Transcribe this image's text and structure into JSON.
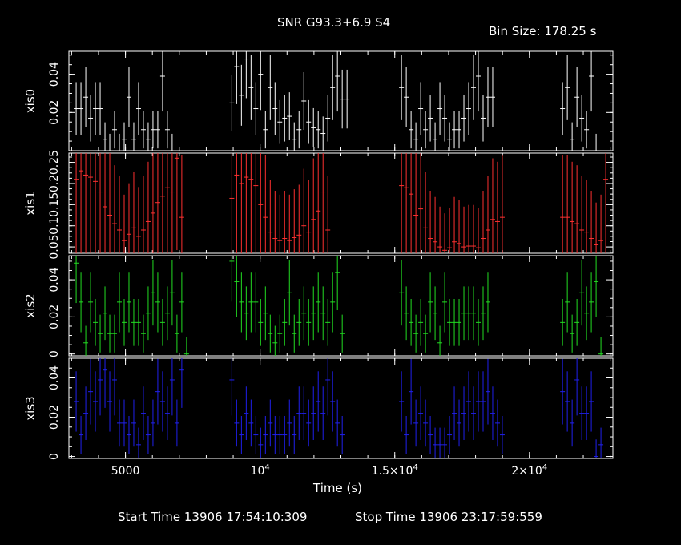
{
  "header": {
    "title": "SNR G93.3+6.9 S4",
    "bin_size": "Bin Size: 178.25 s"
  },
  "footer": {
    "start_time": "Start Time 13906 17:54:10:309",
    "stop_time": "Stop Time 13906 23:17:59:559"
  },
  "chart_data": {
    "type": "scatter",
    "style": "crosshair points with vertical error bars, stacked panels sharing x axis",
    "xlabel": "Time (s)",
    "xlim": [
      2900,
      23100
    ],
    "x_ticks": [
      {
        "value": 5000,
        "label": "5000"
      },
      {
        "value": 10000,
        "label": "10^4"
      },
      {
        "value": 15000,
        "label": "1.5×10^4"
      },
      {
        "value": 20000,
        "label": "2×10^4"
      }
    ],
    "bin_size": 178.25,
    "panels": [
      {
        "name": "xis0",
        "color": "#ffffff",
        "ylim": [
          0,
          0.052
        ],
        "ticks": [
          {
            "value": 0,
            "label": ""
          },
          {
            "value": 0.02,
            "label": "0.02"
          },
          {
            "value": 0.04,
            "label": "0.04"
          }
        ],
        "segments": [
          {
            "x0": 3170,
            "y": [
              0.022,
              0.022,
              0.028,
              0.017,
              0.022,
              0.022,
              0.006,
              0.0,
              0.011,
              0.0,
              0.006,
              0.028,
              0.006,
              0.022,
              0.011,
              0.006,
              0.011,
              0.011,
              0.039,
              0.011,
              0.0
            ]
          },
          {
            "x0": 8950,
            "y": [
              0.025,
              0.044,
              0.029,
              0.048,
              0.033,
              0.022,
              0.04,
              0.011,
              0.033,
              0.022,
              0.015,
              0.017,
              0.018,
              0.006,
              0.011,
              0.026,
              0.015,
              0.012,
              0.011,
              0.009,
              0.017,
              0.033,
              0.039,
              0.027,
              0.027
            ]
          },
          {
            "x0": 15250,
            "y": [
              0.033,
              0.028,
              0.011,
              0.006,
              0.022,
              0.011,
              0.017,
              0.006,
              0.022,
              0.017,
              0.006,
              0.011,
              0.011,
              0.017,
              0.022,
              0.033,
              0.039,
              0.017,
              0.028,
              0.028
            ]
          },
          {
            "x0": 21230,
            "y": [
              0.022,
              0.033,
              0.006,
              0.028,
              0.017,
              0.011,
              0.039,
              0.0
            ]
          }
        ]
      },
      {
        "name": "xis1",
        "color": "#ff3030",
        "ylim": [
          0.035,
          0.272
        ],
        "ticks": [
          {
            "value": 0.05,
            "label": "0.05"
          },
          {
            "value": 0.1,
            "label": "0.1"
          },
          {
            "value": 0.15,
            "label": "0.15"
          },
          {
            "value": 0.2,
            "label": "0.2"
          },
          {
            "value": 0.25,
            "label": "0.25"
          }
        ],
        "segments": [
          {
            "x0": 3170,
            "y": [
              0.21,
              0.23,
              0.22,
              0.215,
              0.205,
              0.18,
              0.145,
              0.125,
              0.105,
              0.09,
              0.065,
              0.08,
              0.095,
              0.075,
              0.09,
              0.11,
              0.13,
              0.155,
              0.17,
              0.19,
              0.18,
              0.26,
              0.12
            ]
          },
          {
            "x0": 8950,
            "y": [
              0.165,
              0.22,
              0.2,
              0.215,
              0.21,
              0.195,
              0.15,
              0.12,
              0.085,
              0.07,
              0.065,
              0.07,
              0.065,
              0.072,
              0.078,
              0.1,
              0.085,
              0.115,
              0.135,
              0.18,
              0.09
            ]
          },
          {
            "x0": 15250,
            "y": [
              0.195,
              0.19,
              0.175,
              0.125,
              0.14,
              0.095,
              0.07,
              0.062,
              0.05,
              0.042,
              0.048,
              0.062,
              0.058,
              0.05,
              0.052,
              0.052,
              0.048,
              0.07,
              0.09,
              0.115,
              0.11,
              0.12
            ]
          },
          {
            "x0": 21230,
            "y": [
              0.12,
              0.12,
              0.11,
              0.105,
              0.09,
              0.085,
              0.07,
              0.055,
              0.065,
              0.21
            ]
          }
        ]
      },
      {
        "name": "xis2",
        "color": "#22dd22",
        "ylim": [
          -0.001,
          0.053
        ],
        "ticks": [
          {
            "value": 0,
            "label": "0"
          },
          {
            "value": 0.02,
            "label": "0.02"
          },
          {
            "value": 0.04,
            "label": "0.04"
          }
        ],
        "segments": [
          {
            "x0": 3170,
            "y": [
              0.049,
              0.028,
              0.006,
              0.028,
              0.017,
              0.011,
              0.022,
              0.011,
              0.011,
              0.028,
              0.017,
              0.028,
              0.017,
              0.017,
              0.011,
              0.022,
              0.033,
              0.028,
              0.017,
              0.022,
              0.033,
              0.011,
              0.028,
              0.0
            ]
          },
          {
            "x0": 8950,
            "y": [
              0.05,
              0.039,
              0.028,
              0.022,
              0.028,
              0.028,
              0.017,
              0.022,
              0.011,
              0.006,
              0.011,
              0.017,
              0.033,
              0.011,
              0.017,
              0.022,
              0.017,
              0.022,
              0.028,
              0.022,
              0.017,
              0.028,
              0.044,
              0.011
            ]
          },
          {
            "x0": 15250,
            "y": [
              0.033,
              0.022,
              0.017,
              0.011,
              0.017,
              0.011,
              0.028,
              0.022,
              0.006,
              0.028,
              0.017,
              0.017,
              0.017,
              0.022,
              0.022,
              0.022,
              0.017,
              0.022,
              0.028
            ]
          },
          {
            "x0": 21230,
            "y": [
              0.017,
              0.028,
              0.011,
              0.017,
              0.033,
              0.022,
              0.028,
              0.039,
              0.0
            ]
          }
        ]
      },
      {
        "name": "xis3",
        "color": "#2020ee",
        "ylim": [
          -0.001,
          0.05
        ],
        "ticks": [
          {
            "value": 0,
            "label": "0"
          },
          {
            "value": 0.02,
            "label": "0.02"
          },
          {
            "value": 0.04,
            "label": "0.04"
          }
        ],
        "segments": [
          {
            "x0": 3170,
            "y": [
              0.028,
              0.011,
              0.022,
              0.033,
              0.028,
              0.039,
              0.044,
              0.028,
              0.039,
              0.017,
              0.017,
              0.011,
              0.017,
              0.006,
              0.022,
              0.011,
              0.017,
              0.033,
              0.028,
              0.022,
              0.039,
              0.017,
              0.044
            ]
          },
          {
            "x0": 8950,
            "y": [
              0.039,
              0.017,
              0.011,
              0.022,
              0.017,
              0.011,
              0.006,
              0.011,
              0.017,
              0.011,
              0.011,
              0.011,
              0.017,
              0.011,
              0.022,
              0.022,
              0.017,
              0.022,
              0.028,
              0.022,
              0.039,
              0.028,
              0.017,
              0.011
            ]
          },
          {
            "x0": 15250,
            "y": [
              0.028,
              0.011,
              0.033,
              0.017,
              0.022,
              0.017,
              0.011,
              0.006,
              0.006,
              0.006,
              0.011,
              0.022,
              0.017,
              0.022,
              0.028,
              0.022,
              0.028,
              0.028,
              0.033,
              0.022,
              0.017,
              0.011
            ]
          },
          {
            "x0": 21230,
            "y": [
              0.033,
              0.028,
              0.017,
              0.039,
              0.022,
              0.022,
              0.028,
              0.0,
              0.006
            ]
          }
        ]
      }
    ]
  }
}
